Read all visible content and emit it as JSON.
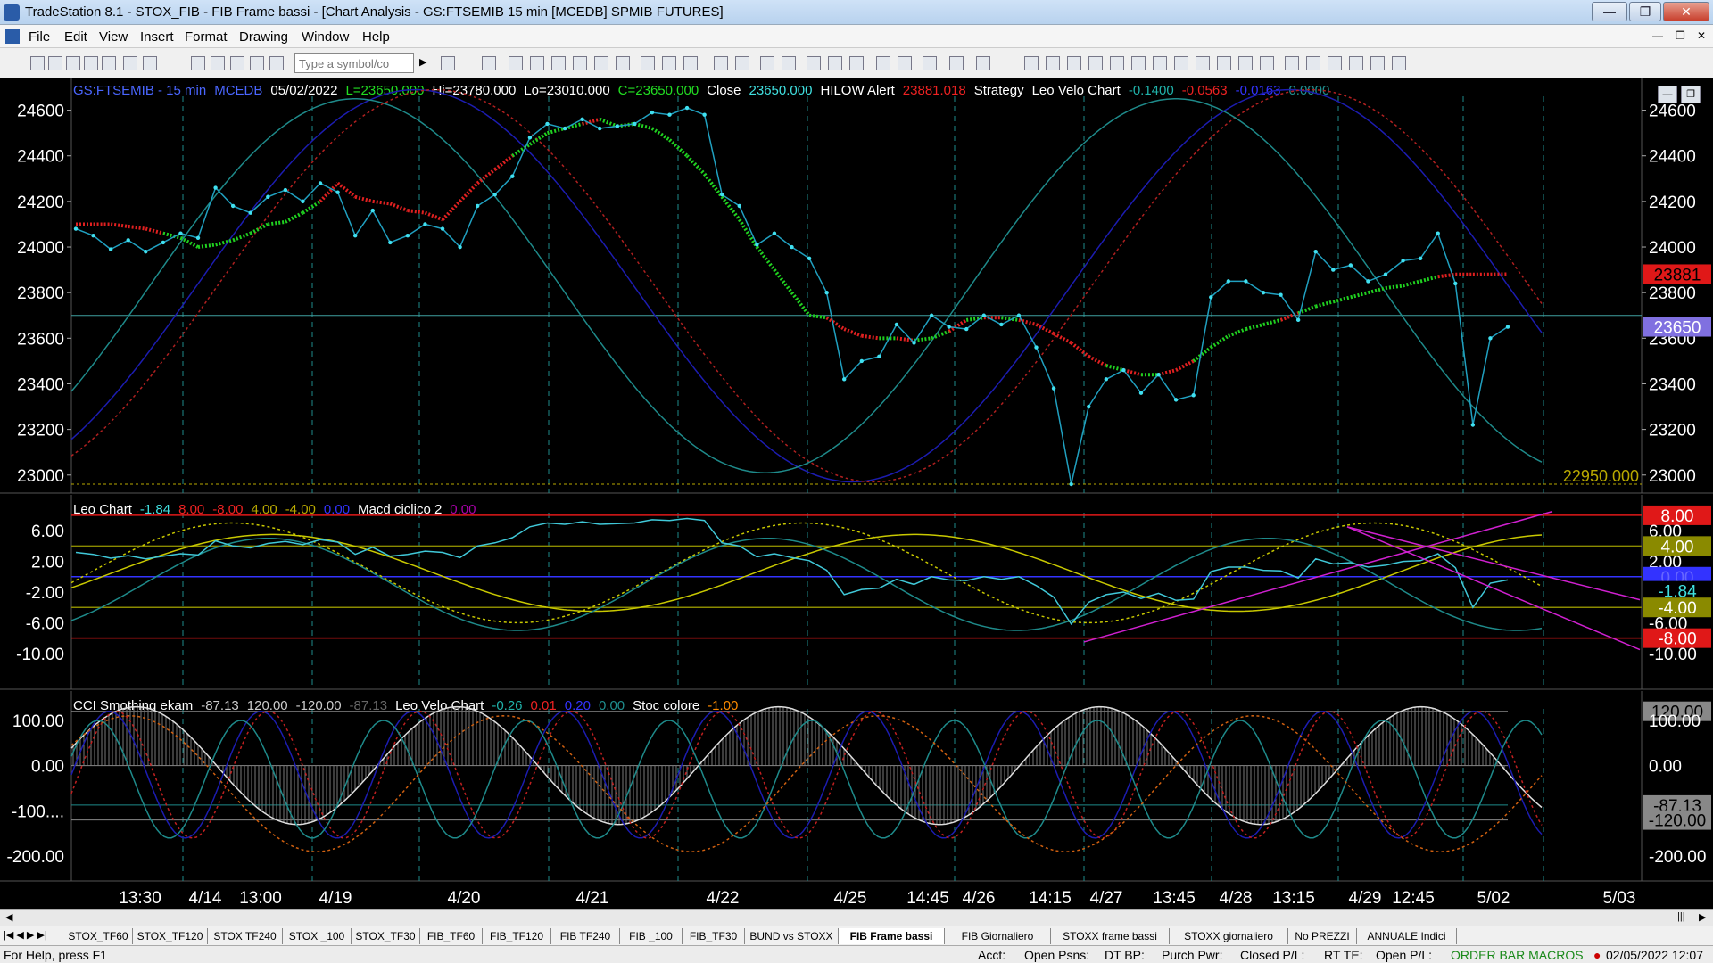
{
  "window": {
    "title": "TradeStation 8.1 - STOX_FIB - FIB Frame bassi - [Chart Analysis - GS:FTSEMIB  15 min  [MCEDB] SPMIB FUTURES]",
    "minimize": "—",
    "restore": "❐",
    "close": "✕",
    "inner_min": "—",
    "inner_restore": "❐",
    "inner_close": "✕"
  },
  "menu": [
    "File",
    "Edit",
    "View",
    "Insert",
    "Format",
    "Drawing",
    "Window",
    "Help"
  ],
  "toolbar": {
    "symbol_placeholder": "Type a symbol/co"
  },
  "chart_data": {
    "type": "line",
    "price_panel": {
      "header": [
        {
          "text": "GS:FTSEMIB - 15 min",
          "color": "#4a66ff"
        },
        {
          "text": "MCEDB",
          "color": "#4a66ff"
        },
        {
          "text": "05/02/2022",
          "color": "#ffffff"
        },
        {
          "text": "L=23650.000",
          "color": "#22dd22"
        },
        {
          "text": "Hi=23780.000",
          "color": "#ffffff"
        },
        {
          "text": "Lo=23010.000",
          "color": "#ffffff"
        },
        {
          "text": "C=23650.000",
          "color": "#22dd22"
        },
        {
          "text": "Close",
          "color": "#ffffff"
        },
        {
          "text": "23650.000",
          "color": "#40e0e0"
        },
        {
          "text": "HILOW Alert",
          "color": "#ffffff"
        },
        {
          "text": "23881.018",
          "color": "#ee2222"
        },
        {
          "text": "Strategy",
          "color": "#ffffff"
        },
        {
          "text": "Leo Velo Chart",
          "color": "#ffffff"
        },
        {
          "text": "-0.1400",
          "color": "#20b2aa"
        },
        {
          "text": "-0.0563",
          "color": "#ee2222"
        },
        {
          "text": "-0.0163",
          "color": "#3333ff"
        },
        {
          "text": "0.0000",
          "color": "#1f8f8f"
        }
      ],
      "y_ticks": [
        "24600",
        "24400",
        "24200",
        "24000",
        "23800",
        "23600",
        "23400",
        "23200",
        "23000"
      ],
      "ylim": [
        22960,
        24700
      ],
      "last_price": "23650",
      "alert_price": "23881",
      "support_label": "22950.000",
      "horizontal_level": 23700,
      "close_series": [
        24080,
        24050,
        23990,
        24030,
        23980,
        24020,
        24060,
        24040,
        24260,
        24180,
        24150,
        24220,
        24250,
        24200,
        24280,
        24240,
        24050,
        24160,
        24020,
        24050,
        24100,
        24080,
        24000,
        24180,
        24230,
        24310,
        24480,
        24540,
        24520,
        24560,
        24520,
        24530,
        24540,
        24590,
        24580,
        24610,
        24580,
        24230,
        24180,
        24010,
        24060,
        24000,
        23950,
        23800,
        23420,
        23500,
        23520,
        23660,
        23580,
        23700,
        23650,
        23640,
        23700,
        23660,
        23700,
        23560,
        23380,
        22960,
        23300,
        23420,
        23460,
        23360,
        23440,
        23330,
        23350,
        23780,
        23850,
        23850,
        23800,
        23790,
        23680,
        23980,
        23900,
        23920,
        23850,
        23880,
        23940,
        23950,
        24060,
        23840,
        23220,
        23600,
        23650
      ],
      "hilow_series": [
        24100,
        24100,
        24100,
        24090,
        24080,
        24060,
        24040,
        24000,
        24010,
        24030,
        24060,
        24100,
        24110,
        24150,
        24200,
        24280,
        24220,
        24200,
        24190,
        24160,
        24150,
        24120,
        24200,
        24280,
        24340,
        24400,
        24450,
        24500,
        24520,
        24540,
        24560,
        24530,
        24540,
        24520,
        24470,
        24400,
        24320,
        24220,
        24120,
        24000,
        23900,
        23800,
        23700,
        23690,
        23640,
        23610,
        23600,
        23600,
        23590,
        23600,
        23630,
        23680,
        23690,
        23690,
        23680,
        23660,
        23620,
        23580,
        23520,
        23480,
        23460,
        23440,
        23440,
        23460,
        23500,
        23560,
        23610,
        23640,
        23660,
        23680,
        23710,
        23740,
        23760,
        23780,
        23800,
        23820,
        23830,
        23850,
        23870,
        23880,
        23880,
        23880,
        23881
      ]
    },
    "oscillator_panel": {
      "header": [
        {
          "text": "Leo Chart",
          "color": "#ffffff"
        },
        {
          "text": "-1.84",
          "color": "#40e0e0"
        },
        {
          "text": "8.00",
          "color": "#ee2222"
        },
        {
          "text": "-8.00",
          "color": "#ee2222"
        },
        {
          "text": "4.00",
          "color": "#b8a800"
        },
        {
          "text": "-4.00",
          "color": "#b8a800"
        },
        {
          "text": "0.00",
          "color": "#3333ff"
        },
        {
          "text": "Macd ciclico 2",
          "color": "#ffffff"
        },
        {
          "text": "0.00",
          "color": "#aa00aa"
        }
      ],
      "y_ticks": [
        "6.00",
        "2.00",
        "-2.00",
        "-6.00",
        "-10.00"
      ],
      "ylim": [
        -13.5,
        9.5
      ],
      "right_labels": [
        "8.00",
        "6.00",
        "4.00",
        "2.00",
        "0.00",
        "-1.84",
        "-4.00",
        "-6.00",
        "-8.00",
        "-10.00"
      ],
      "levels": [
        8,
        4,
        0,
        -4,
        -8
      ]
    },
    "cci_panel": {
      "header": [
        {
          "text": "CCI Smothing ekam",
          "color": "#ffffff"
        },
        {
          "text": "-87.13",
          "color": "#cccccc"
        },
        {
          "text": "120.00",
          "color": "#cccccc"
        },
        {
          "text": "-120.00",
          "color": "#cccccc"
        },
        {
          "text": "-87.13",
          "color": "#666666"
        },
        {
          "text": "Leo Velo Chart",
          "color": "#ffffff"
        },
        {
          "text": "-0.26",
          "color": "#20b2aa"
        },
        {
          "text": "0.01",
          "color": "#ee2222"
        },
        {
          "text": "0.20",
          "color": "#3333ff"
        },
        {
          "text": "0.00",
          "color": "#1f8f8f"
        },
        {
          "text": "Stoc colore",
          "color": "#ffffff"
        },
        {
          "text": "-1.00",
          "color": "#ff8c00"
        }
      ],
      "y_ticks": [
        "100.00",
        "0.00",
        "-100....",
        "-200.00"
      ],
      "ylim": [
        -235,
        145
      ],
      "right_labels": [
        "120.00",
        "100.00",
        "0.00",
        "-87.13",
        "-120.00",
        "-200.00"
      ]
    },
    "x_labels": [
      "13:30",
      "4/14",
      "13:00",
      "4/19",
      "4/20",
      "4/21",
      "4/22",
      "4/25",
      "14:45",
      "4/26",
      "14:15",
      "4/27",
      "13:45",
      "4/28",
      "13:15",
      "4/29",
      "12:45",
      "5/02",
      "5/03"
    ]
  },
  "tabs": [
    "STOX_TF60",
    "STOX_TF120",
    "STOX TF240",
    "STOX _100",
    "STOX_TF30",
    "FIB_TF60",
    "FIB_TF120",
    "FIB TF240",
    "FIB _100",
    "FIB_TF30",
    "BUND vs STOXX",
    "FIB Frame bassi",
    "FIB Giornaliero",
    "STOXX frame bassi",
    "STOXX giornaliero",
    "No PREZZI",
    "ANNUALE Indici"
  ],
  "status": {
    "help": "For Help, press F1",
    "acct": "Acct:",
    "open_psns": "Open Psns:",
    "dt_bp": "DT BP:",
    "purch_pwr": "Purch Pwr:",
    "closed_pl": "Closed P/L:",
    "rt_te": "RT TE:",
    "open_pl": "Open P/L:",
    "macros": "ORDER BAR  MACROS",
    "datetime": "02/05/2022 12:07"
  }
}
